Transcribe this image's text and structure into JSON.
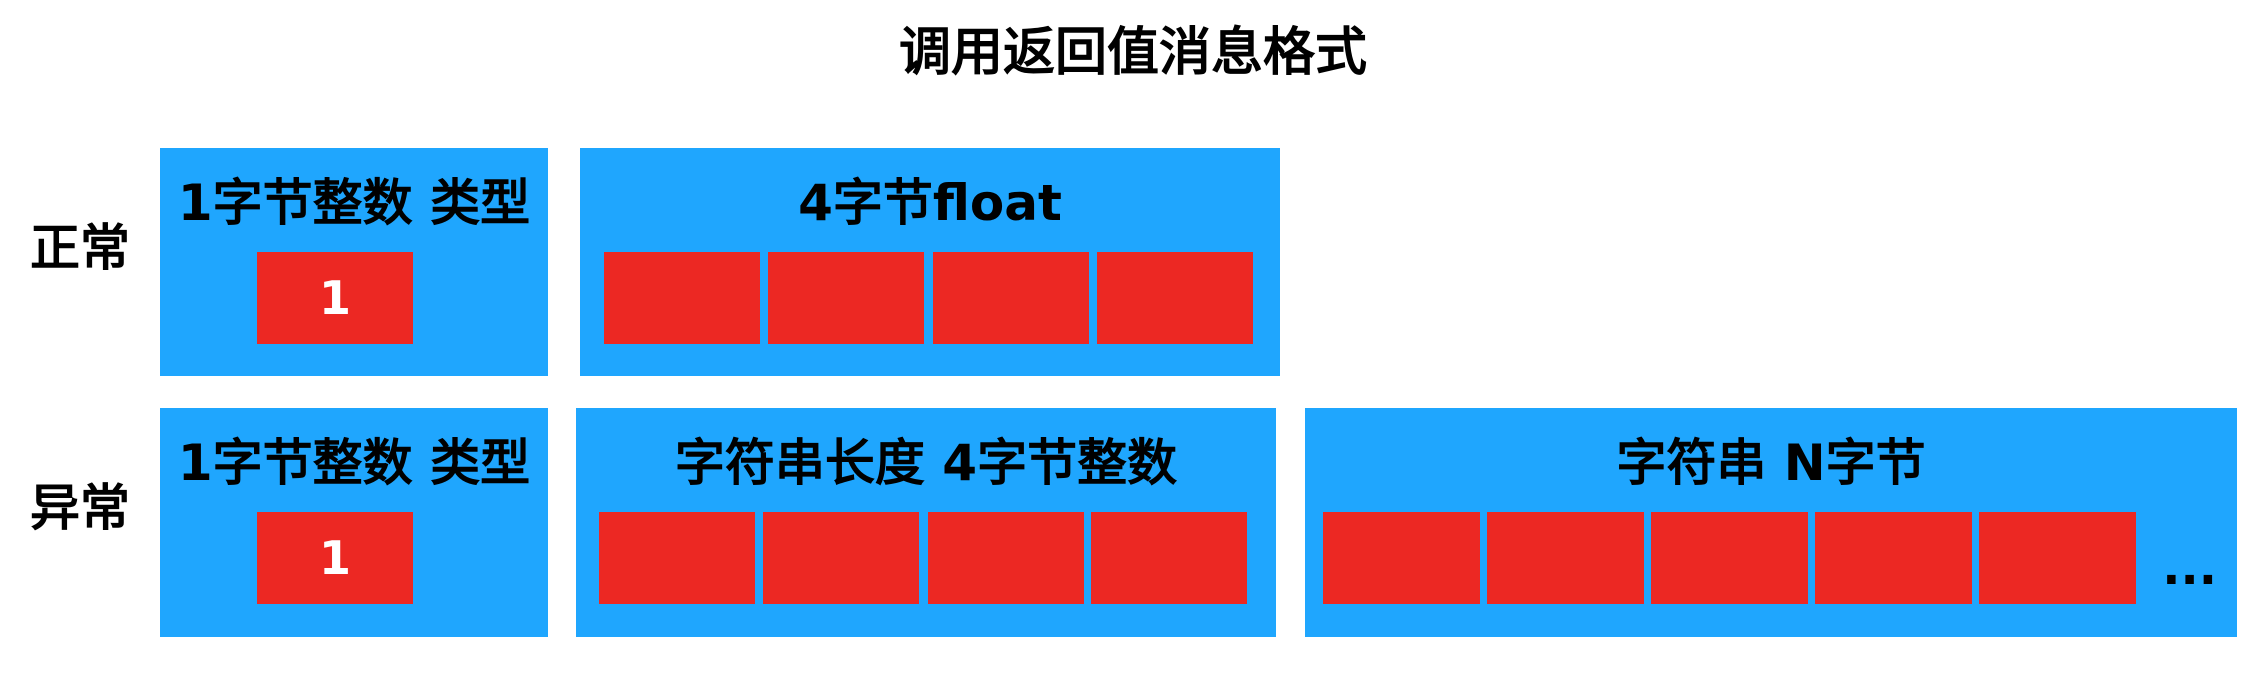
{
  "title": "调用返回值消息格式",
  "rows": {
    "normal": {
      "label": "正常",
      "type_box": {
        "label": "1字节整数 类型",
        "value": "1"
      },
      "float_box": {
        "label": "4字节float"
      }
    },
    "exception": {
      "label": "异常",
      "type_box": {
        "label": "1字节整数 类型",
        "value": "1"
      },
      "length_box": {
        "label": "字符串长度 4字节整数"
      },
      "string_box": {
        "label": "字符串 N字节",
        "more": "..."
      }
    }
  },
  "colors": {
    "box": "#1fa6fe",
    "cell": "#ec2823"
  }
}
